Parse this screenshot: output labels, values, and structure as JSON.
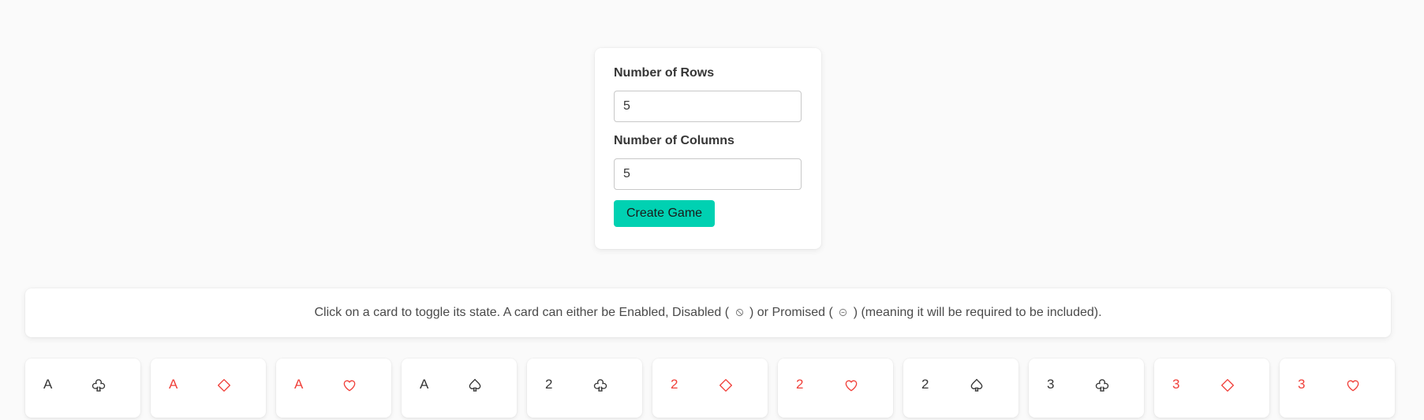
{
  "config": {
    "rows_label": "Number of Rows",
    "rows_value": "5",
    "columns_label": "Number of Columns",
    "columns_value": "5",
    "create_button": "Create Game"
  },
  "info": {
    "text_before_disabled": "Click on a card to toggle its state. A card can either be Enabled, Disabled (",
    "text_between": ") or Promised (",
    "text_after": ") (meaning it will be required to be included).",
    "disabled_icon": "ban-icon",
    "promised_icon": "circle-dot-icon"
  },
  "colors": {
    "accent": "#00d1b2",
    "red_suit": "#f0403a",
    "black_suit": "#363636"
  },
  "cards": [
    {
      "rank": "A",
      "suit": "club",
      "color": "black"
    },
    {
      "rank": "A",
      "suit": "diamond",
      "color": "red"
    },
    {
      "rank": "A",
      "suit": "heart",
      "color": "red"
    },
    {
      "rank": "A",
      "suit": "spade",
      "color": "black"
    },
    {
      "rank": "2",
      "suit": "club",
      "color": "black"
    },
    {
      "rank": "2",
      "suit": "diamond",
      "color": "red"
    },
    {
      "rank": "2",
      "suit": "heart",
      "color": "red"
    },
    {
      "rank": "2",
      "suit": "spade",
      "color": "black"
    },
    {
      "rank": "3",
      "suit": "club",
      "color": "black"
    },
    {
      "rank": "3",
      "suit": "diamond",
      "color": "red"
    },
    {
      "rank": "3",
      "suit": "heart",
      "color": "red"
    }
  ]
}
